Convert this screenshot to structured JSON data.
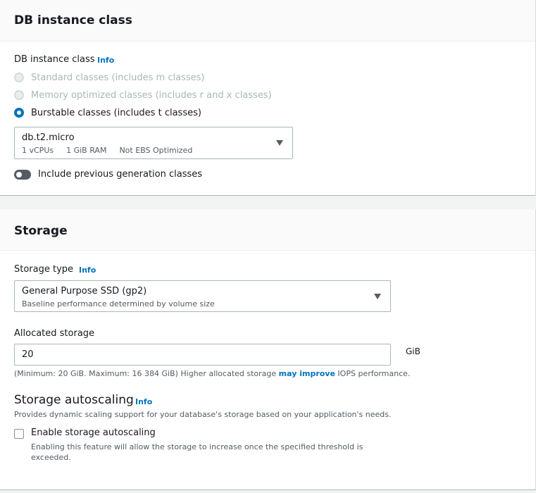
{
  "instance_section": {
    "title": "DB instance class",
    "field_label": "DB instance class",
    "info": "Info",
    "radios": [
      {
        "label": "Standard classes (includes m classes)",
        "state": "disabled"
      },
      {
        "label": "Memory optimized classes (includes r and x classes)",
        "state": "disabled"
      },
      {
        "label": "Burstable classes (includes t classes)",
        "state": "selected"
      }
    ],
    "select": {
      "value": "db.t2.micro",
      "details": [
        "1 vCPUs",
        "1 GiB RAM",
        "Not EBS Optimized"
      ]
    },
    "toggle": {
      "label": "Include previous generation classes",
      "on": false
    }
  },
  "storage_section": {
    "title": "Storage",
    "storage_type": {
      "label": "Storage type",
      "info": "Info",
      "value": "General Purpose SSD (gp2)",
      "description": "Baseline performance determined by volume size"
    },
    "allocated": {
      "label": "Allocated storage",
      "value": "20",
      "unit": "GiB",
      "hint_before": "(Minimum: 20 GiB. Maximum: 16 384 GiB) Higher allocated storage ",
      "hint_link": "may improve",
      "hint_after": " IOPS performance."
    },
    "autoscaling": {
      "title": "Storage autoscaling",
      "info": "Info",
      "description": "Provides dynamic scaling support for your database's storage based on your application's needs.",
      "checkbox_label": "Enable storage autoscaling",
      "checkbox_checked": false,
      "checkbox_description": "Enabling this feature will allow the storage to increase once the specified threshold is exceeded."
    }
  },
  "colors": {
    "accent": "#0073bb",
    "text": "#16191f",
    "muted": "#545b64",
    "border": "#aab7b8"
  },
  "icons": {
    "select_caret": "caret-down-icon"
  }
}
